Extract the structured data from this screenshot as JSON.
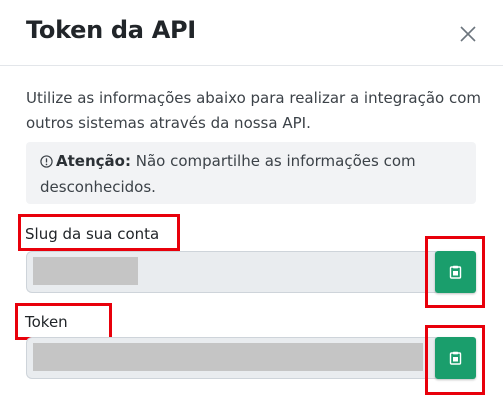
{
  "modal": {
    "title": "Token da API",
    "intro": "Utilize as informações abaixo para realizar a integração com outros sistemas através da nossa API.",
    "alert": {
      "icon": "info-circle-icon",
      "label": "Atenção:",
      "text": "Não compartilhe as informações com desconhecidos."
    },
    "fields": [
      {
        "label": "Slug da sua conta",
        "value": "",
        "copy_icon": "clipboard-icon"
      },
      {
        "label": "Token",
        "value": "",
        "copy_icon": "clipboard-icon"
      }
    ],
    "colors": {
      "highlight": "#e8000b",
      "copy_button": "#1a9e6c",
      "input_bg": "#e9ecef",
      "redaction": "#c5c5c5"
    }
  }
}
